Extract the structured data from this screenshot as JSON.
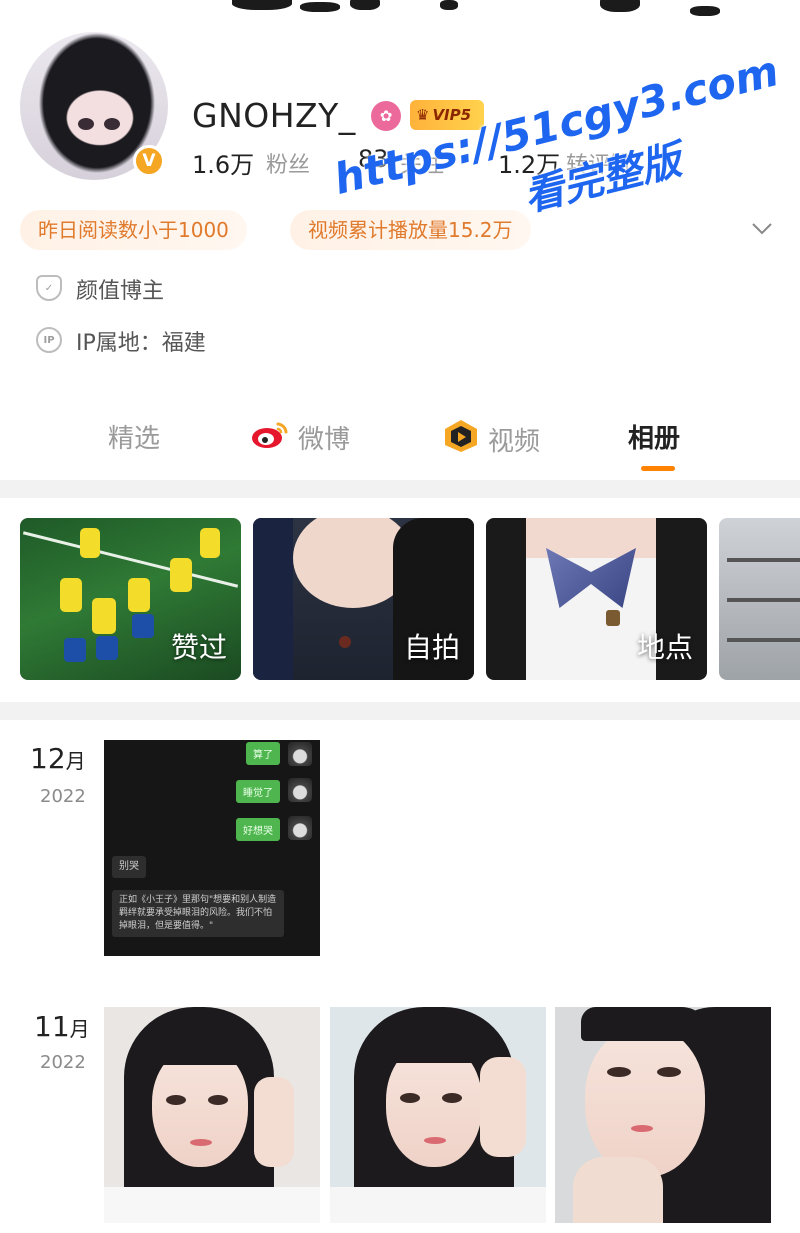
{
  "profile": {
    "username": "GNOHZY_",
    "verified_glyph": "V",
    "vip_label": "VIP5",
    "stats": [
      {
        "value": "1.6万",
        "label": "粉丝"
      },
      {
        "value": "83",
        "label": "关注"
      },
      {
        "value": "1.2万",
        "label": "转评赞"
      }
    ],
    "tags": [
      "昨日阅读数小于1000",
      "视频累计播放量15.2万"
    ],
    "info": [
      {
        "icon": "shield-icon",
        "text": "颜值博主"
      },
      {
        "icon": "ip-icon",
        "icon_text": "IP",
        "text": "IP属地：福建"
      }
    ]
  },
  "watermark": {
    "line1": "https://51cgy3.com",
    "line2": "看完整版"
  },
  "tabs": [
    {
      "label": "精选",
      "icon": ""
    },
    {
      "label": "微博",
      "icon": "weibo-icon"
    },
    {
      "label": "视频",
      "icon": "video-icon"
    },
    {
      "label": "相册",
      "icon": "",
      "active": true
    }
  ],
  "albums": [
    {
      "label": "赞过"
    },
    {
      "label": "自拍"
    },
    {
      "label": "地点"
    },
    {
      "label": ""
    }
  ],
  "timeline": [
    {
      "month": "12",
      "month_unit": "月",
      "year": "2022",
      "chat": {
        "bubbles": [
          "算了",
          "睡觉了",
          "好想哭"
        ],
        "reply": "别哭",
        "quote": "正如《小王子》里那句\"想要和别人制造羁绊就要承受掉眼泪的风险。我们不怕掉眼泪，但是要值得。\""
      }
    },
    {
      "month": "11",
      "month_unit": "月",
      "year": "2022"
    }
  ],
  "colors": {
    "accent": "#ff8200",
    "tag_text": "#e07a2c",
    "watermark": "#1e66f0",
    "verified": "#f5a623"
  }
}
